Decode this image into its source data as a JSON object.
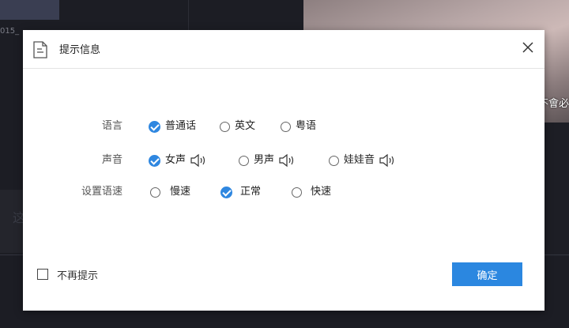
{
  "background": {
    "left_text": "015_",
    "photo_caption": "不會必",
    "side_glyph": "这"
  },
  "dialog": {
    "title": "提示信息",
    "rows": [
      {
        "label": "语言",
        "options": [
          {
            "label": "普通话",
            "checked": true
          },
          {
            "label": "英文",
            "checked": false
          },
          {
            "label": "粤语",
            "checked": false
          }
        ]
      },
      {
        "label": "声音",
        "options": [
          {
            "label": "女声",
            "checked": true,
            "icon": "speaker-icon"
          },
          {
            "label": "男声",
            "checked": false,
            "icon": "speaker-icon"
          },
          {
            "label": "娃娃音",
            "checked": false,
            "icon": "speaker-icon"
          }
        ]
      },
      {
        "label": "设置语速",
        "options": [
          {
            "label": "慢速",
            "checked": false
          },
          {
            "label": "正常",
            "checked": true
          },
          {
            "label": "快速",
            "checked": false
          }
        ]
      }
    ],
    "dont_remind_label": "不再提示",
    "dont_remind_checked": false,
    "confirm_label": "确定"
  },
  "colors": {
    "accent": "#2b87e0",
    "page_bg": "#1c1d24"
  }
}
